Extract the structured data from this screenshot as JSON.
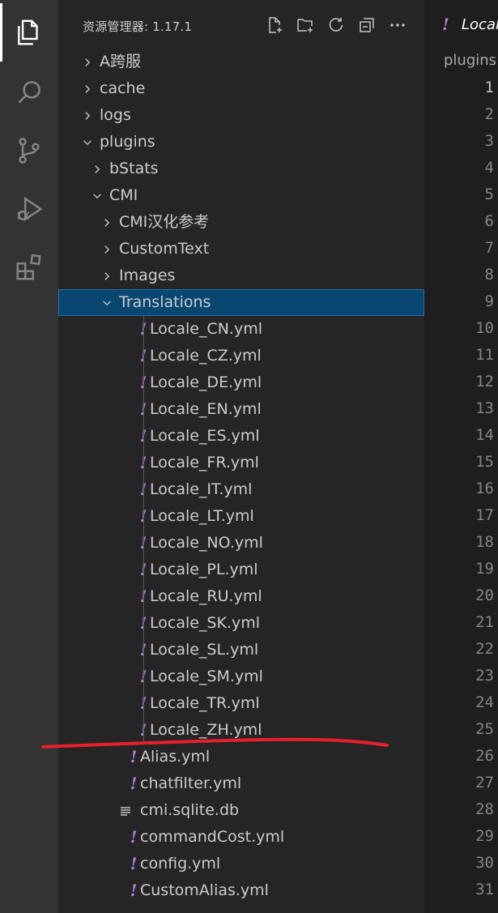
{
  "explorer": {
    "title": "资源管理器: 1.17.1",
    "actions": [
      "new-file",
      "new-folder",
      "refresh",
      "collapse-all",
      "more"
    ]
  },
  "tree": [
    {
      "label": "A跨服",
      "kind": "folder",
      "depth": 0,
      "open": false
    },
    {
      "label": "cache",
      "kind": "folder",
      "depth": 0,
      "open": false
    },
    {
      "label": "logs",
      "kind": "folder",
      "depth": 0,
      "open": false
    },
    {
      "label": "plugins",
      "kind": "folder",
      "depth": 0,
      "open": true
    },
    {
      "label": "bStats",
      "kind": "folder",
      "depth": 1,
      "open": false
    },
    {
      "label": "CMI",
      "kind": "folder",
      "depth": 1,
      "open": true
    },
    {
      "label": "CMI汉化参考",
      "kind": "folder",
      "depth": 2,
      "open": false
    },
    {
      "label": "CustomText",
      "kind": "folder",
      "depth": 2,
      "open": false
    },
    {
      "label": "Images",
      "kind": "folder",
      "depth": 2,
      "open": false
    },
    {
      "label": "Translations",
      "kind": "folder",
      "depth": 2,
      "open": true,
      "selected": true
    },
    {
      "label": "Locale_CN.yml",
      "kind": "yml",
      "depth": 3
    },
    {
      "label": "Locale_CZ.yml",
      "kind": "yml",
      "depth": 3
    },
    {
      "label": "Locale_DE.yml",
      "kind": "yml",
      "depth": 3
    },
    {
      "label": "Locale_EN.yml",
      "kind": "yml",
      "depth": 3
    },
    {
      "label": "Locale_ES.yml",
      "kind": "yml",
      "depth": 3
    },
    {
      "label": "Locale_FR.yml",
      "kind": "yml",
      "depth": 3
    },
    {
      "label": "Locale_IT.yml",
      "kind": "yml",
      "depth": 3
    },
    {
      "label": "Locale_LT.yml",
      "kind": "yml",
      "depth": 3
    },
    {
      "label": "Locale_NO.yml",
      "kind": "yml",
      "depth": 3
    },
    {
      "label": "Locale_PL.yml",
      "kind": "yml",
      "depth": 3
    },
    {
      "label": "Locale_RU.yml",
      "kind": "yml",
      "depth": 3
    },
    {
      "label": "Locale_SK.yml",
      "kind": "yml",
      "depth": 3
    },
    {
      "label": "Locale_SL.yml",
      "kind": "yml",
      "depth": 3
    },
    {
      "label": "Locale_SM.yml",
      "kind": "yml",
      "depth": 3
    },
    {
      "label": "Locale_TR.yml",
      "kind": "yml",
      "depth": 3
    },
    {
      "label": "Locale_ZH.yml",
      "kind": "yml",
      "depth": 3
    },
    {
      "label": "Alias.yml",
      "kind": "yml",
      "depth": 2
    },
    {
      "label": "chatfilter.yml",
      "kind": "yml",
      "depth": 2
    },
    {
      "label": "cmi.sqlite.db",
      "kind": "db",
      "depth": 2
    },
    {
      "label": "commandCost.yml",
      "kind": "yml",
      "depth": 2
    },
    {
      "label": "config.yml",
      "kind": "yml",
      "depth": 2
    },
    {
      "label": "CustomAlias.yml",
      "kind": "yml",
      "depth": 2
    }
  ],
  "editor": {
    "tab_icon": "!",
    "tab_label": "Locale",
    "breadcrumb": "plugins",
    "line_numbers": [
      "1",
      "2",
      "3",
      "4",
      "5",
      "6",
      "7",
      "8",
      "9",
      "10",
      "11",
      "12",
      "13",
      "14",
      "15",
      "16",
      "17",
      "18",
      "19",
      "20",
      "21",
      "22",
      "23",
      "24",
      "25",
      "26",
      "27",
      "28",
      "29",
      "30",
      "31"
    ],
    "active_line": "1"
  },
  "colors": {
    "activity_bar": "#333333",
    "sidebar": "#252526",
    "editor": "#1e1e1e",
    "selection": "#094771",
    "yaml_icon": "#b07ee0",
    "annotation": "#e8202a"
  }
}
